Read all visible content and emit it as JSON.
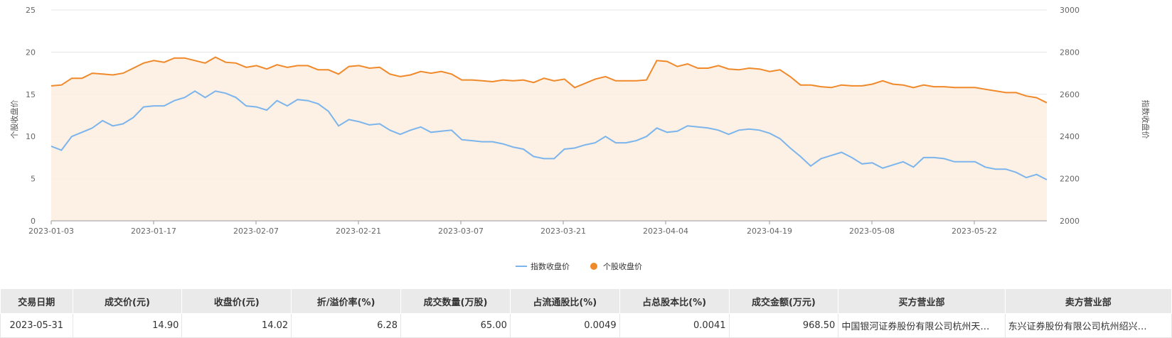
{
  "chart_data": {
    "type": "line",
    "legend": [
      "指数收盘价",
      "个股收盘价"
    ],
    "y_left": {
      "label": "个股收盘价",
      "range": [
        0,
        25
      ],
      "ticks": [
        "0",
        "5",
        "10",
        "15",
        "20",
        "25"
      ]
    },
    "y_right": {
      "label": "指数收盘价",
      "range": [
        2000,
        3000
      ],
      "ticks": [
        "2000",
        "2200",
        "2400",
        "2600",
        "2800",
        "3000"
      ]
    },
    "x_ticks": [
      "2023-01-03",
      "2023-01-17",
      "2023-02-07",
      "2023-02-21",
      "2023-03-07",
      "2023-03-21",
      "2023-04-04",
      "2023-04-19",
      "2023-05-08",
      "2023-05-22"
    ],
    "series": [
      {
        "name": "个股收盘价",
        "axis": "left",
        "color": "#f0892a",
        "values": [
          16.0,
          16.1,
          16.9,
          16.9,
          17.5,
          17.4,
          17.3,
          17.5,
          18.1,
          18.7,
          19.0,
          18.8,
          19.3,
          19.3,
          19.0,
          18.7,
          19.4,
          18.8,
          18.7,
          18.2,
          18.4,
          18.0,
          18.5,
          18.2,
          18.4,
          18.4,
          17.9,
          17.9,
          17.4,
          18.3,
          18.4,
          18.1,
          18.2,
          17.4,
          17.1,
          17.3,
          17.7,
          17.5,
          17.7,
          17.4,
          16.7,
          16.7,
          16.6,
          16.5,
          16.7,
          16.6,
          16.7,
          16.4,
          16.9,
          16.6,
          16.8,
          15.8,
          16.3,
          16.8,
          17.1,
          16.6,
          16.6,
          16.6,
          16.7,
          19.0,
          18.9,
          18.3,
          18.6,
          18.1,
          18.1,
          18.4,
          18.0,
          17.9,
          18.1,
          18.0,
          17.7,
          17.9,
          17.1,
          16.1,
          16.1,
          15.9,
          15.8,
          16.1,
          16.0,
          16.0,
          16.2,
          16.6,
          16.2,
          16.1,
          15.8,
          16.1,
          15.9,
          15.9,
          15.8,
          15.8,
          15.8,
          15.6,
          15.4,
          15.2,
          15.2,
          14.8,
          14.6,
          14.0
        ]
      },
      {
        "name": "指数收盘价",
        "axis": "right",
        "color": "#7cb5ec",
        "values": [
          2354,
          2335,
          2400,
          2420,
          2440,
          2475,
          2450,
          2460,
          2490,
          2540,
          2545,
          2545,
          2570,
          2585,
          2615,
          2585,
          2615,
          2605,
          2585,
          2545,
          2540,
          2525,
          2570,
          2545,
          2575,
          2570,
          2555,
          2520,
          2450,
          2480,
          2470,
          2455,
          2460,
          2430,
          2410,
          2430,
          2445,
          2420,
          2425,
          2430,
          2385,
          2380,
          2375,
          2375,
          2365,
          2350,
          2340,
          2305,
          2295,
          2295,
          2340,
          2345,
          2360,
          2370,
          2400,
          2370,
          2370,
          2380,
          2400,
          2440,
          2420,
          2425,
          2450,
          2445,
          2440,
          2430,
          2410,
          2430,
          2435,
          2430,
          2415,
          2390,
          2345,
          2305,
          2260,
          2295,
          2310,
          2325,
          2300,
          2270,
          2275,
          2250,
          2265,
          2280,
          2255,
          2300,
          2300,
          2295,
          2280,
          2280,
          2280,
          2255,
          2245,
          2245,
          2230,
          2205,
          2220,
          2195
        ]
      }
    ]
  },
  "table": {
    "headers": [
      "交易日期",
      "成交价(元)",
      "收盘价(元)",
      "折/溢价率(%)",
      "成交数量(万股)",
      "占流通股比(%)",
      "占总股本比(%)",
      "成交金额(万元)",
      "买方营业部",
      "卖方营业部"
    ],
    "rows": [
      [
        "2023-05-31",
        "14.90",
        "14.02",
        "6.28",
        "65.00",
        "0.0049",
        "0.0041",
        "968.50",
        "中国银河证券股份有限公司杭州天…",
        "东兴证券股份有限公司杭州绍兴…"
      ]
    ]
  }
}
